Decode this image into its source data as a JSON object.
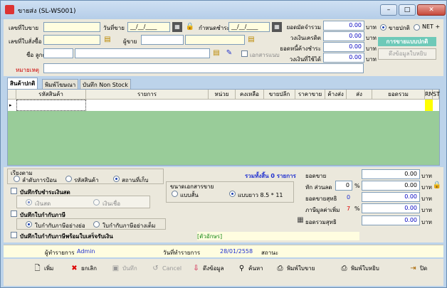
{
  "window": {
    "title": "ขายส่ง (SL-WS001)"
  },
  "header": {
    "doc_no_label": "เลขที่ใบขาย",
    "date_label": "วันที่ขาย",
    "date_value": "__/__/____",
    "due_label": "กำหนดชำระ",
    "due_value": "__/__/____",
    "order_no_label": "เลขที่ใบสั่งซื้อ",
    "seller_label": "ผู้ขาย",
    "customer_label": "ชื่อ ลูกค้า",
    "vat_doc_label": "เอกสารแนบ",
    "remark_label": "หมายเหตุ"
  },
  "credit": {
    "credit_limit_label": "ยอดมัดจำรวม",
    "credit_limit_value": "0.00",
    "credit_avail_label": "วงเงินเครดิต",
    "credit_avail_value": "0.00",
    "outstanding_label": "ยอดหนี้ค้างชำระ",
    "outstanding_value": "0.00",
    "remaining_label": "วงเงินที่ใช้ได้",
    "remaining_value": "0.00",
    "unit": "บาท"
  },
  "sale_type": {
    "normal_label": "ขายปกติ",
    "net_label": "NET +",
    "banner": "การขายแบบปกติ",
    "pull_button": "ดึงข้อมูลใบหยิบ"
  },
  "tabs": [
    "สินค้าปกติ",
    "พิมพ์โฆษณา",
    "บันทึก Non Stock"
  ],
  "grid_headers": [
    "รหัสสินค้า",
    "รายการ",
    "หน่วย",
    "คงเหลือ",
    "ขายปลีก",
    "ราคาขาย",
    "ค้างส่ง",
    "ส่ง",
    "ยอดรวม",
    "RM",
    "ST"
  ],
  "sort": {
    "label": "เรียงตาม",
    "opt1": "ลำดับการป้อน",
    "opt2": "รหัสสินค้า",
    "opt3": "สถานที่เก็บ"
  },
  "cash": {
    "label": "บันทึกรับชำระเงินสด",
    "opt1": "เงินสด",
    "opt2": "เงินเชื่อ"
  },
  "tax": {
    "label": "บันทึกใบกำกับภาษี",
    "opt1": "ใบกำกับภาษีอย่างย่อ",
    "opt2": "ใบกำกับภาษีอย่างเต็ม"
  },
  "receipt_label": "บันทึกใบกำกับภาษีพร้อมใบเสร็จรับเงิน",
  "amount_text": "[ตัวอักษร]",
  "total_items": "รวมทั้งสิ้น 0 รายการ",
  "paper": {
    "label": "ขนาดเอกสารขาย",
    "opt1": "แบบสั้น",
    "opt2": "แบบยาว 8.5 * 11"
  },
  "summary": {
    "sales_label": "ยอดขาย",
    "sales_value": "0.00",
    "discount_label": "หัก ส่วนลด",
    "discount_pct": "0",
    "discount_value": "0.00",
    "net_label": "ยอดขายสุทธิ",
    "net_pct": "0",
    "net_value": "0.00",
    "vat_label": "ภาษีมูลค่าเพิ่ม",
    "vat_pct": "7",
    "vat_value": "0.00",
    "grand_label": "ยอดรวมสุทธิ",
    "grand_value": "0.00",
    "unit": "บาท",
    "pct": "%"
  },
  "footer": {
    "creator_label": "ผู้ทำรายการ",
    "creator_value": "Admin",
    "date_label": "วันที่ทำรายการ",
    "date_value": "28/01/2558",
    "status_label": "สถานะ"
  },
  "toolbar": {
    "new": "เพิ่ม",
    "cancel_doc": "ยกเลิก",
    "save": "บันทึก",
    "cancel": "Cancel",
    "pull": "ดึงข้อมูล",
    "search": "ค้นหา",
    "print_sale": "พิมพ์ใบขาย",
    "print_pick": "พิมพ์ใบหยิบ",
    "close": "ปิด"
  }
}
